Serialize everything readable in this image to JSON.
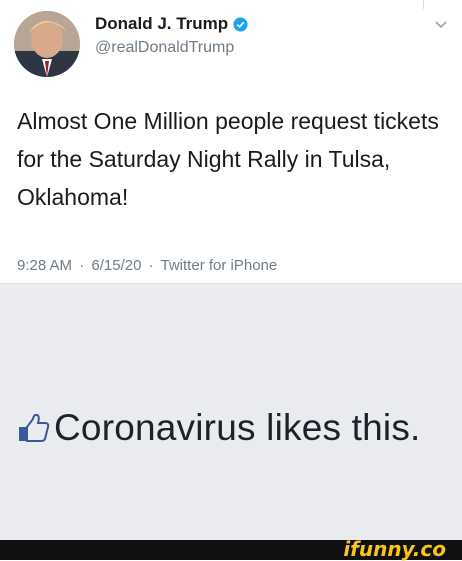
{
  "tweet": {
    "display_name": "Donald J. Trump",
    "handle": "@realDonaldTrump",
    "text": "Almost One Million people request tickets for the Saturday Night Rally in Tulsa, Oklahoma!",
    "time": "9:28 AM",
    "separator": "·",
    "date": "6/15/20",
    "source": "Twitter for iPhone",
    "verified_icon": "verified-badge-icon",
    "menu_icon": "chevron-down-icon"
  },
  "overlay": {
    "like_text": "Coronavirus likes this.",
    "like_icon": "thumbs-up-icon"
  },
  "watermark": {
    "text": "ifunny.co"
  },
  "colors": {
    "verified": "#1da1f2",
    "meta_gray": "#6f7d88",
    "fb_background": "#e9ebee",
    "ifunny_yellow": "#f5c518"
  }
}
